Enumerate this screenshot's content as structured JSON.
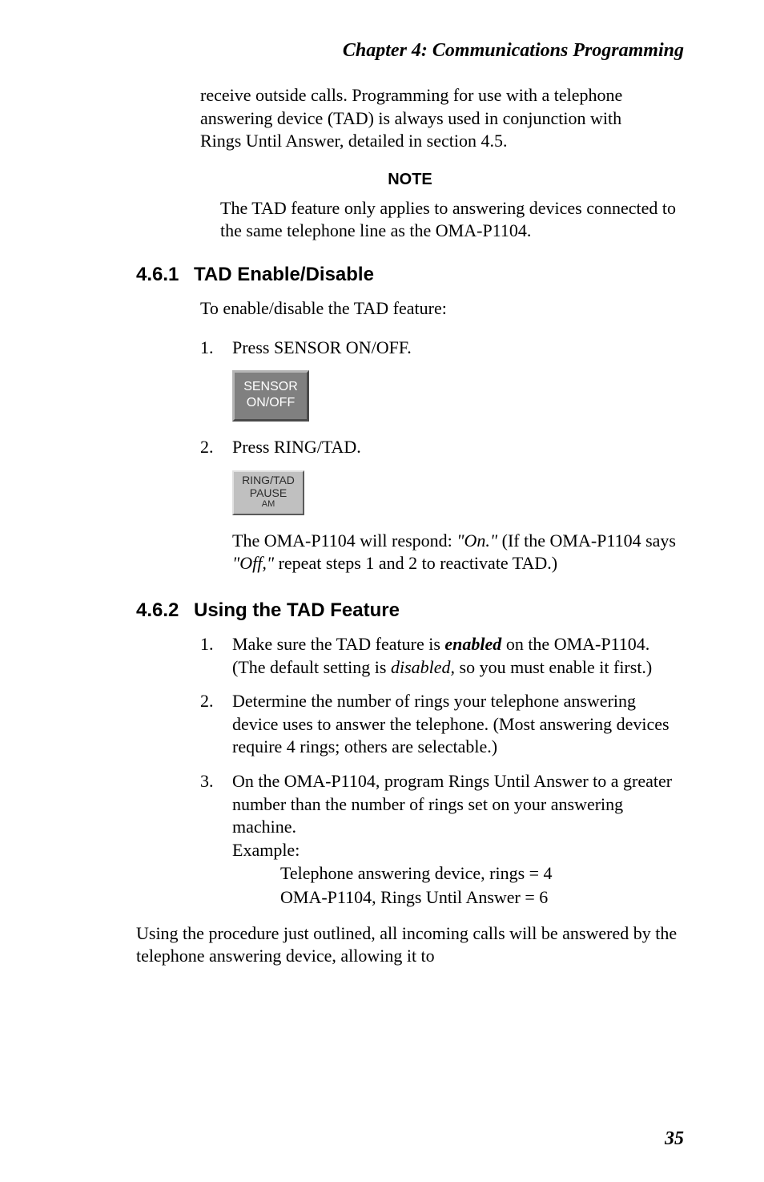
{
  "chapter_title": "Chapter 4: Communications Programming",
  "intro_para": "receive outside calls. Programming for use with a telephone answering device (TAD) is always used in conjunction with Rings Until Answer, detailed in section 4.5.",
  "note": {
    "heading": "NOTE",
    "body": "The TAD feature only applies to answering devices connected to the same telephone line as the OMA-P1104."
  },
  "sec1": {
    "num": "4.6.1",
    "title": "TAD Enable/Disable",
    "intro": "To enable/disable the TAD feature:",
    "step1_num": "1.",
    "step1_text": "Press SENSOR ON/OFF.",
    "btn1_l1": "SENSOR",
    "btn1_l2": "ON/OFF",
    "step2_num": "2.",
    "step2_text": "Press RING/TAD.",
    "btn2_l1": "RING/TAD",
    "btn2_l2": "PAUSE",
    "btn2_l3": "AM",
    "respond_pre": "The OMA-P1104 will respond: ",
    "respond_on": "\"On.\"",
    "respond_mid": " (If the OMA-P1104 says ",
    "respond_off": "\"Off,\"",
    "respond_post": " repeat steps 1 and 2 to reactivate TAD.)"
  },
  "sec2": {
    "num": "4.6.2",
    "title": "Using the TAD Feature",
    "s1_num": "1.",
    "s1_a": "Make sure the TAD feature is ",
    "s1_b": "enabled",
    "s1_c": " on the OMA-P1104. (The default setting is ",
    "s1_d": "disabled,",
    "s1_e": " so you must enable it first.)",
    "s2_num": "2.",
    "s2": "Determine the number of rings your telephone answering device uses to answer the telephone. (Most answering devices require 4 rings; others are selectable.)",
    "s3_num": "3.",
    "s3": "On the OMA-P1104, program Rings Until Answer to a greater number than the number of rings set on your answering machine.",
    "ex_label": "Example:",
    "ex_l1": "Telephone answering device, rings = 4",
    "ex_l2": "OMA-P1104, Rings Until Answer = 6",
    "closing": "Using the procedure just outlined, all incoming calls will be answered by the telephone answering device, allowing it to"
  },
  "page_number": "35"
}
